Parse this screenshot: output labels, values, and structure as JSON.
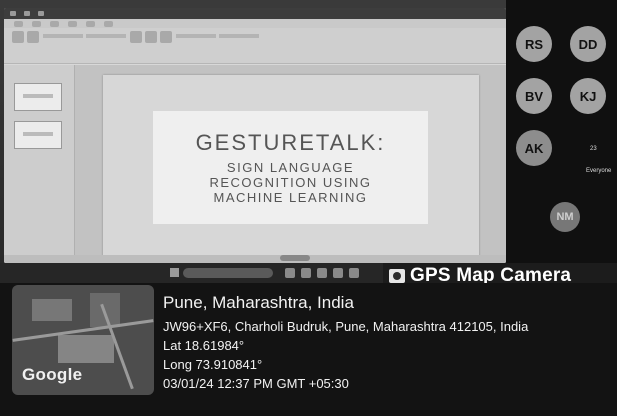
{
  "presentation": {
    "slide_title": "GESTURETALK:",
    "slide_subtitle_lines": [
      "SIGN LANGUAGE",
      "RECOGNITION USING",
      "MACHINE LEARNING"
    ]
  },
  "meeting": {
    "participants": [
      {
        "initials": "RS"
      },
      {
        "initials": "DD"
      },
      {
        "initials": "BV"
      },
      {
        "initials": "KJ"
      },
      {
        "initials": "AK"
      },
      {
        "initials": "NM"
      }
    ],
    "others_label": "Everyone",
    "others_count": "23"
  },
  "gps": {
    "app_label": "GPS Map Camera",
    "map_brand": "Google",
    "location": "Pune, Maharashtra, India",
    "address": "JW96+XF6, Charholi Budruk, Pune, Maharashtra 412105, India",
    "lat": "Lat 18.61984°",
    "long": "Long 73.910841°",
    "datetime": "03/01/24 12:37 PM GMT +05:30"
  },
  "icons": {
    "camera": "camera-icon"
  }
}
